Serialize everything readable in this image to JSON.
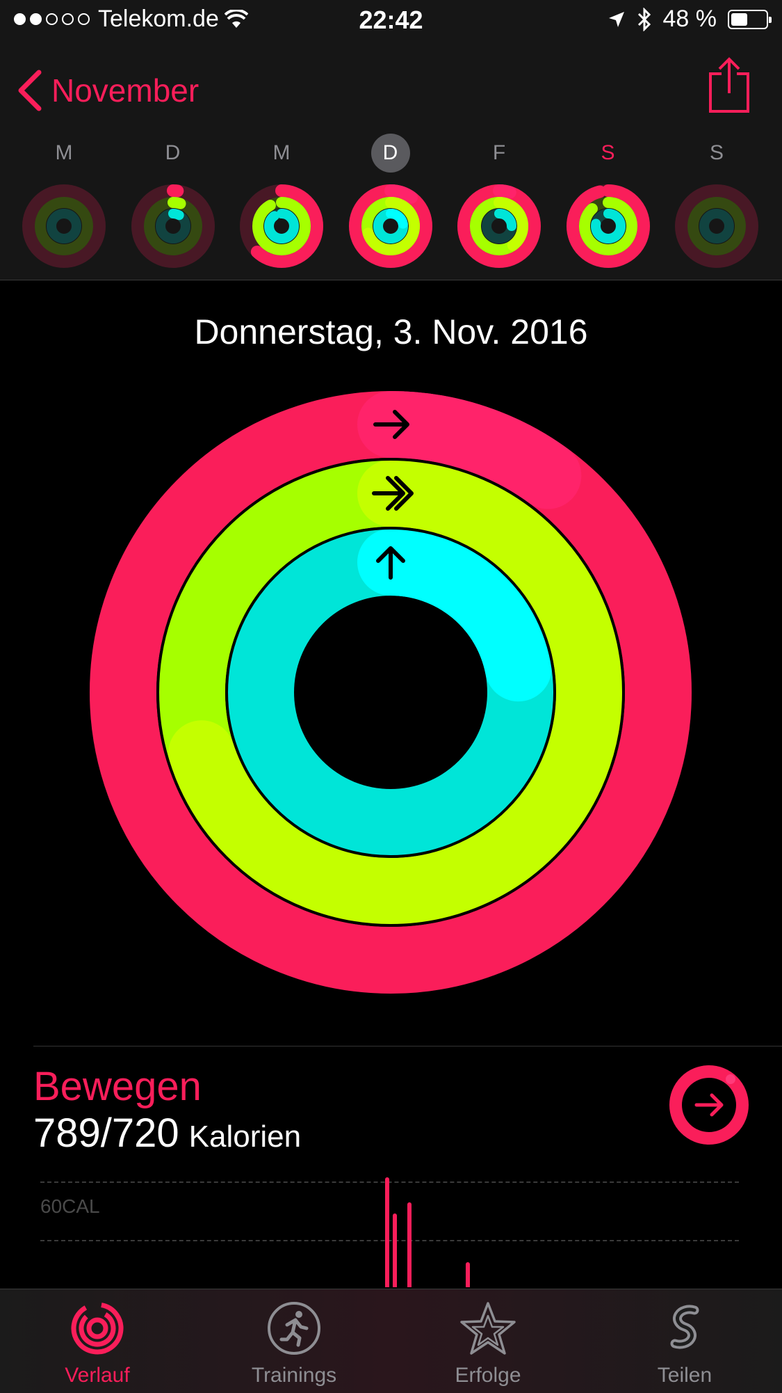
{
  "status_bar": {
    "carrier": "Telekom.de",
    "time": "22:42",
    "battery_percent": "48 %",
    "battery_level": 0.48
  },
  "nav": {
    "back_label": "November",
    "share_icon": "share-icon"
  },
  "week": {
    "days": [
      {
        "label": "M",
        "move": 0.0,
        "exercise": 0.0,
        "stand": 0.0
      },
      {
        "label": "D",
        "move": 0.02,
        "exercise": 0.05,
        "stand": 0.08
      },
      {
        "label": "M",
        "move": 0.62,
        "exercise": 0.92,
        "stand": 0.9
      },
      {
        "label": "D",
        "move": 1.1,
        "exercise": 1.7,
        "stand": 1.22,
        "selected": true
      },
      {
        "label": "F",
        "move": 1.05,
        "exercise": 1.4,
        "stand": 0.25
      },
      {
        "label": "S",
        "move": 0.96,
        "exercise": 0.88,
        "stand": 0.78
      },
      {
        "label": "S",
        "move": 0.0,
        "exercise": 0.0,
        "stand": 0.0
      }
    ]
  },
  "date_title": "Donnerstag, 3. Nov. 2016",
  "rings": {
    "move": 1.1,
    "exercise": 1.7,
    "stand": 1.22,
    "colors": {
      "move": "#fa1e5a",
      "exercise": "#a6ff00",
      "stand": "#00e5d8"
    }
  },
  "move_section": {
    "title": "Bewegen",
    "value": "789/720",
    "unit": "Kalorien",
    "chart_label": "60CAL"
  },
  "tabs": [
    {
      "label": "Verlauf",
      "icon": "history-rings-icon",
      "active": true
    },
    {
      "label": "Trainings",
      "icon": "runner-icon",
      "active": false
    },
    {
      "label": "Erfolge",
      "icon": "star-icon",
      "active": false
    },
    {
      "label": "Teilen",
      "icon": "share-rings-icon",
      "active": false
    }
  ]
}
